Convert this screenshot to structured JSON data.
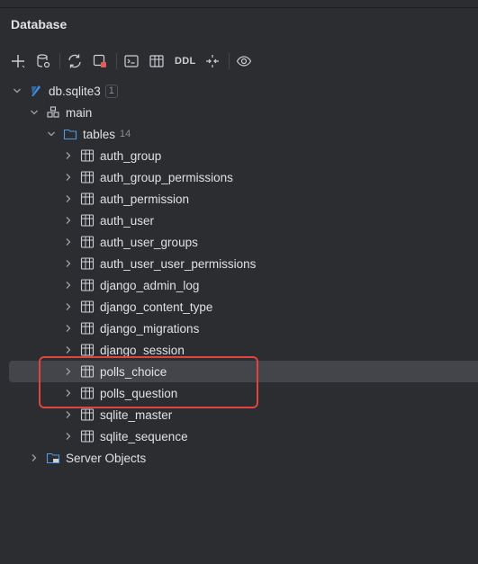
{
  "panel": {
    "title": "Database"
  },
  "toolbar": {
    "buttons": [
      {
        "name": "add-icon"
      },
      {
        "name": "datasource-properties-icon"
      },
      {
        "name": "refresh-icon"
      },
      {
        "name": "disconnect-icon"
      },
      {
        "name": "console-icon"
      },
      {
        "name": "table-editor-icon"
      },
      {
        "name": "ddl",
        "label": "DDL"
      },
      {
        "name": "compare-icon"
      },
      {
        "name": "view-options-icon"
      }
    ]
  },
  "tree": {
    "datasource": {
      "label": "db.sqlite3",
      "badge": "1"
    },
    "schema": {
      "label": "main"
    },
    "tables_folder": {
      "label": "tables",
      "count": "14"
    },
    "tables": [
      "auth_group",
      "auth_group_permissions",
      "auth_permission",
      "auth_user",
      "auth_user_groups",
      "auth_user_user_permissions",
      "django_admin_log",
      "django_content_type",
      "django_migrations",
      "django_session",
      "polls_choice",
      "polls_question",
      "sqlite_master",
      "sqlite_sequence"
    ],
    "server_objects": {
      "label": "Server Objects"
    }
  },
  "colors": {
    "background": "#2b2d30",
    "selection": "#43454a",
    "highlight_box": "#e0443e",
    "sqlite_icon": "#3d8ee6"
  }
}
